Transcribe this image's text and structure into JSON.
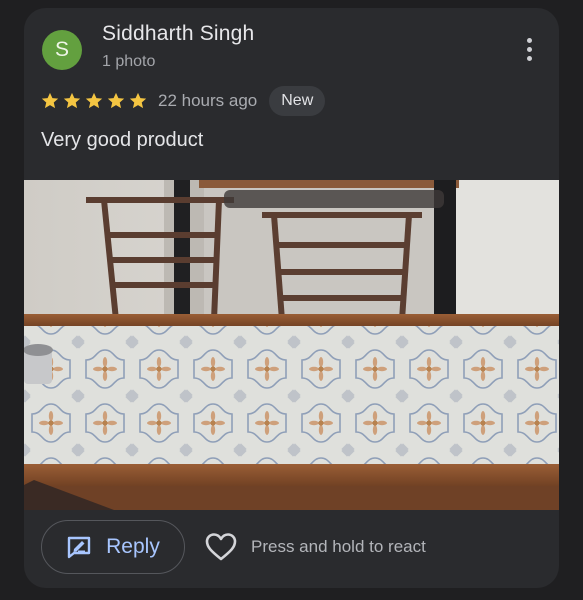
{
  "review": {
    "avatar_letter": "S",
    "reviewer_name": "Siddharth Singh",
    "reviewer_meta": "1 photo",
    "rating": 5,
    "rating_max": 5,
    "time_ago": "22 hours ago",
    "badge": "New",
    "text": "Very good product"
  },
  "actions": {
    "reply_label": "Reply",
    "react_label": "Press and hold to react"
  },
  "colors": {
    "avatar_bg": "#63a03f",
    "star": "#f4c542",
    "reply_accent": "#a8c6ff",
    "card_bg": "#2a2b2e"
  },
  "icons": {
    "more": "more-vert-icon",
    "reply": "reply-edit-icon",
    "react": "heart-outline-icon",
    "star": "star-icon"
  }
}
